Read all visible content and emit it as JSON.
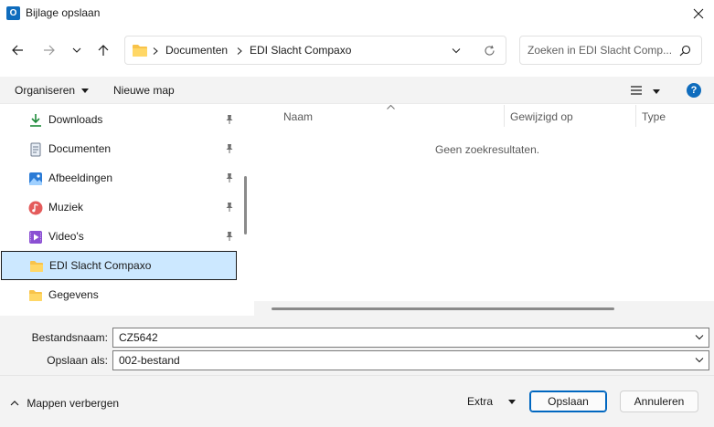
{
  "window": {
    "title": "Bijlage opslaan",
    "app_icon_letter": "O"
  },
  "address": {
    "path": [
      "Documenten",
      "EDI Slacht Compaxo"
    ]
  },
  "search": {
    "placeholder": "Zoeken in EDI Slacht Comp..."
  },
  "commands": {
    "organize": "Organiseren",
    "new_folder": "Nieuwe map"
  },
  "nav_items": [
    {
      "label": "Downloads",
      "icon": "download-icon",
      "pinned": true
    },
    {
      "label": "Documenten",
      "icon": "document-icon",
      "pinned": true
    },
    {
      "label": "Afbeeldingen",
      "icon": "pictures-icon",
      "pinned": true
    },
    {
      "label": "Muziek",
      "icon": "music-icon",
      "pinned": true
    },
    {
      "label": "Video's",
      "icon": "video-icon",
      "pinned": true
    },
    {
      "label": "EDI Slacht Compaxo",
      "icon": "folder-icon",
      "pinned": false,
      "selected": true
    },
    {
      "label": "Gegevens",
      "icon": "folder-icon",
      "pinned": false
    }
  ],
  "columns": [
    "Naam",
    "Gewijzigd op",
    "Type"
  ],
  "empty_message": "Geen zoekresultaten.",
  "form": {
    "filename_label": "Bestandsnaam:",
    "filename_value": "CZ5642",
    "saveas_label": "Opslaan als:",
    "saveas_value": "002-bestand"
  },
  "footer": {
    "hide_folders": "Mappen verbergen",
    "extra": "Extra",
    "save": "Opslaan",
    "cancel": "Annuleren"
  },
  "colors": {
    "accent": "#0067c0",
    "selection": "#cce8ff",
    "folder": "#f8c34a",
    "help": "#0f6cbd"
  }
}
